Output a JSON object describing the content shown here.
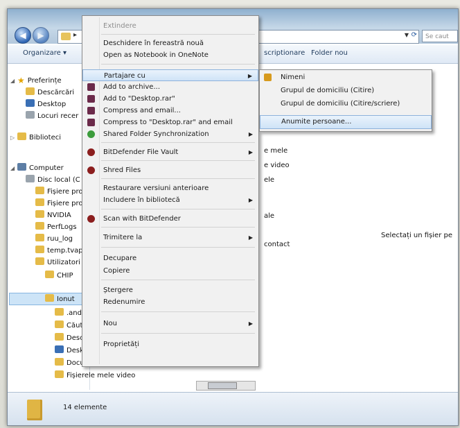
{
  "address": {
    "search_placeholder": "Se caut"
  },
  "toolbar": {
    "organize": "Organizare ▾",
    "burn": "scriptionare",
    "new_folder": "Folder nou"
  },
  "nav": {
    "favorites": "Preferințe",
    "downloads": "Descărcări",
    "desktop": "Desktop",
    "recent": "Locuri recer",
    "libraries": "Biblioteci",
    "computer": "Computer",
    "local_disk": "Disc local (C",
    "prog1": "Fișiere pro",
    "prog2": "Fișiere pro",
    "nvidia": "NVIDIA",
    "perflogs": "PerfLogs",
    "ruu_log": "ruu_log",
    "temp": "temp.tvap",
    "users": "Utilizatori",
    "chip": "CHIP",
    "ionut": "Ionut",
    "android": ".andro",
    "cauta": "Căută",
    "desca": "Descă",
    "deskt": "Deskto",
    "documents": "Documentele mele",
    "videos": "Fișierele mele video"
  },
  "content": {
    "items": [
      "e mele",
      "e video",
      "ele",
      "ale",
      "contact"
    ],
    "preview_text": "Selectați un fișier pe"
  },
  "status": {
    "count": "14 elemente"
  },
  "context_menu": {
    "extend": "Extindere",
    "open_new_window": "Deschidere în fereastră nouă",
    "open_onenote": "Open as Notebook in OneNote",
    "share_with": "Partajare cu",
    "add_archive": "Add to archive...",
    "add_desktop_rar": "Add to \"Desktop.rar\"",
    "compress_email": "Compress and email...",
    "compress_rar_email": "Compress to \"Desktop.rar\" and email",
    "shared_sync": "Shared Folder Synchronization",
    "bd_vault": "BitDefender File Vault",
    "shred": "Shred Files",
    "restore": "Restaurare versiuni anterioare",
    "include_library": "Includere în bibliotecă",
    "scan_bd": "Scan with BitDefender",
    "send_to": "Trimitere la",
    "cut": "Decupare",
    "copy": "Copiere",
    "delete": "Ștergere",
    "rename": "Redenumire",
    "new": "Nou",
    "properties": "Proprietăți"
  },
  "submenu": {
    "nobody": "Nimeni",
    "homegroup_read": "Grupul de domiciliu (Citire)",
    "homegroup_rw": "Grupul de domiciliu (Citire/scriere)",
    "specific": "Anumite persoane..."
  },
  "colors": {
    "highlight": "#cfe3f7",
    "folder": "#e5bb48",
    "titlebar": "#8fb0cf"
  }
}
